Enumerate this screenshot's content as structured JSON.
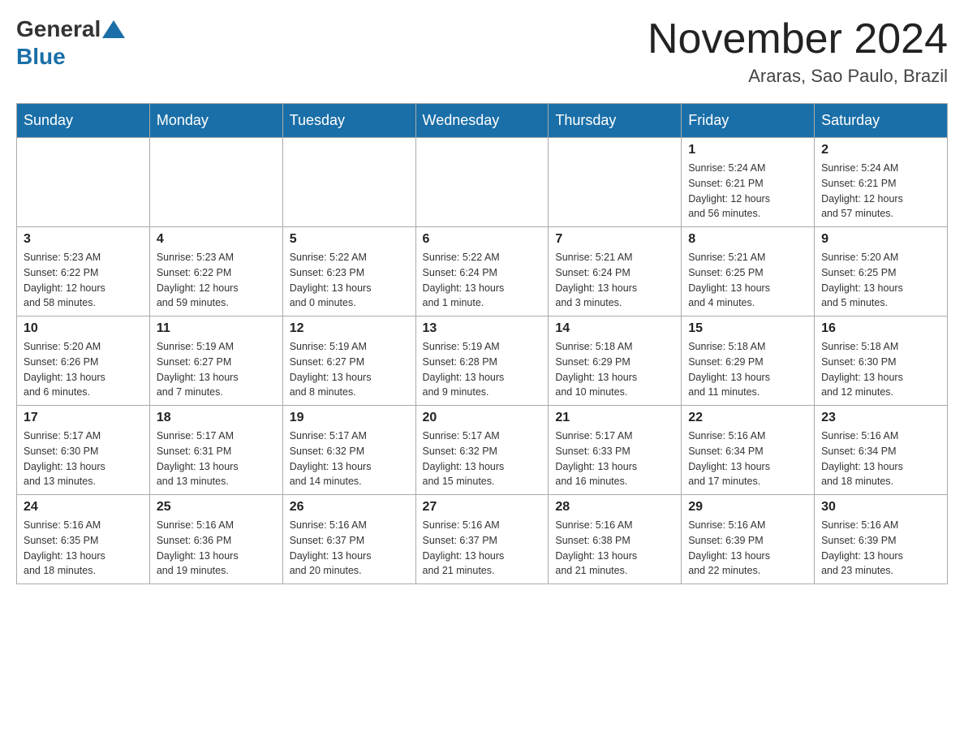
{
  "header": {
    "logo": {
      "general": "General",
      "blue": "Blue"
    },
    "title": "November 2024",
    "location": "Araras, Sao Paulo, Brazil"
  },
  "days_of_week": [
    "Sunday",
    "Monday",
    "Tuesday",
    "Wednesday",
    "Thursday",
    "Friday",
    "Saturday"
  ],
  "weeks": [
    {
      "days": [
        {
          "number": "",
          "info": ""
        },
        {
          "number": "",
          "info": ""
        },
        {
          "number": "",
          "info": ""
        },
        {
          "number": "",
          "info": ""
        },
        {
          "number": "",
          "info": ""
        },
        {
          "number": "1",
          "info": "Sunrise: 5:24 AM\nSunset: 6:21 PM\nDaylight: 12 hours\nand 56 minutes."
        },
        {
          "number": "2",
          "info": "Sunrise: 5:24 AM\nSunset: 6:21 PM\nDaylight: 12 hours\nand 57 minutes."
        }
      ]
    },
    {
      "days": [
        {
          "number": "3",
          "info": "Sunrise: 5:23 AM\nSunset: 6:22 PM\nDaylight: 12 hours\nand 58 minutes."
        },
        {
          "number": "4",
          "info": "Sunrise: 5:23 AM\nSunset: 6:22 PM\nDaylight: 12 hours\nand 59 minutes."
        },
        {
          "number": "5",
          "info": "Sunrise: 5:22 AM\nSunset: 6:23 PM\nDaylight: 13 hours\nand 0 minutes."
        },
        {
          "number": "6",
          "info": "Sunrise: 5:22 AM\nSunset: 6:24 PM\nDaylight: 13 hours\nand 1 minute."
        },
        {
          "number": "7",
          "info": "Sunrise: 5:21 AM\nSunset: 6:24 PM\nDaylight: 13 hours\nand 3 minutes."
        },
        {
          "number": "8",
          "info": "Sunrise: 5:21 AM\nSunset: 6:25 PM\nDaylight: 13 hours\nand 4 minutes."
        },
        {
          "number": "9",
          "info": "Sunrise: 5:20 AM\nSunset: 6:25 PM\nDaylight: 13 hours\nand 5 minutes."
        }
      ]
    },
    {
      "days": [
        {
          "number": "10",
          "info": "Sunrise: 5:20 AM\nSunset: 6:26 PM\nDaylight: 13 hours\nand 6 minutes."
        },
        {
          "number": "11",
          "info": "Sunrise: 5:19 AM\nSunset: 6:27 PM\nDaylight: 13 hours\nand 7 minutes."
        },
        {
          "number": "12",
          "info": "Sunrise: 5:19 AM\nSunset: 6:27 PM\nDaylight: 13 hours\nand 8 minutes."
        },
        {
          "number": "13",
          "info": "Sunrise: 5:19 AM\nSunset: 6:28 PM\nDaylight: 13 hours\nand 9 minutes."
        },
        {
          "number": "14",
          "info": "Sunrise: 5:18 AM\nSunset: 6:29 PM\nDaylight: 13 hours\nand 10 minutes."
        },
        {
          "number": "15",
          "info": "Sunrise: 5:18 AM\nSunset: 6:29 PM\nDaylight: 13 hours\nand 11 minutes."
        },
        {
          "number": "16",
          "info": "Sunrise: 5:18 AM\nSunset: 6:30 PM\nDaylight: 13 hours\nand 12 minutes."
        }
      ]
    },
    {
      "days": [
        {
          "number": "17",
          "info": "Sunrise: 5:17 AM\nSunset: 6:30 PM\nDaylight: 13 hours\nand 13 minutes."
        },
        {
          "number": "18",
          "info": "Sunrise: 5:17 AM\nSunset: 6:31 PM\nDaylight: 13 hours\nand 13 minutes."
        },
        {
          "number": "19",
          "info": "Sunrise: 5:17 AM\nSunset: 6:32 PM\nDaylight: 13 hours\nand 14 minutes."
        },
        {
          "number": "20",
          "info": "Sunrise: 5:17 AM\nSunset: 6:32 PM\nDaylight: 13 hours\nand 15 minutes."
        },
        {
          "number": "21",
          "info": "Sunrise: 5:17 AM\nSunset: 6:33 PM\nDaylight: 13 hours\nand 16 minutes."
        },
        {
          "number": "22",
          "info": "Sunrise: 5:16 AM\nSunset: 6:34 PM\nDaylight: 13 hours\nand 17 minutes."
        },
        {
          "number": "23",
          "info": "Sunrise: 5:16 AM\nSunset: 6:34 PM\nDaylight: 13 hours\nand 18 minutes."
        }
      ]
    },
    {
      "days": [
        {
          "number": "24",
          "info": "Sunrise: 5:16 AM\nSunset: 6:35 PM\nDaylight: 13 hours\nand 18 minutes."
        },
        {
          "number": "25",
          "info": "Sunrise: 5:16 AM\nSunset: 6:36 PM\nDaylight: 13 hours\nand 19 minutes."
        },
        {
          "number": "26",
          "info": "Sunrise: 5:16 AM\nSunset: 6:37 PM\nDaylight: 13 hours\nand 20 minutes."
        },
        {
          "number": "27",
          "info": "Sunrise: 5:16 AM\nSunset: 6:37 PM\nDaylight: 13 hours\nand 21 minutes."
        },
        {
          "number": "28",
          "info": "Sunrise: 5:16 AM\nSunset: 6:38 PM\nDaylight: 13 hours\nand 21 minutes."
        },
        {
          "number": "29",
          "info": "Sunrise: 5:16 AM\nSunset: 6:39 PM\nDaylight: 13 hours\nand 22 minutes."
        },
        {
          "number": "30",
          "info": "Sunrise: 5:16 AM\nSunset: 6:39 PM\nDaylight: 13 hours\nand 23 minutes."
        }
      ]
    }
  ]
}
